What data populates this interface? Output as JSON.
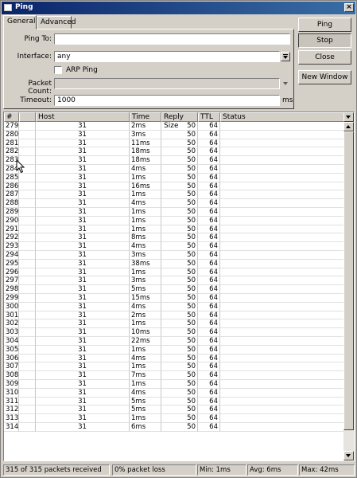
{
  "window": {
    "title": "Ping",
    "close_glyph": "×"
  },
  "tabs": [
    {
      "label": "General"
    },
    {
      "label": "Advanced"
    }
  ],
  "form": {
    "ping_to": {
      "label": "Ping To:",
      "value": ""
    },
    "interface": {
      "label": "Interface:",
      "value": "any"
    },
    "arp_ping": {
      "label": "ARP Ping",
      "checked": false
    },
    "packet_count": {
      "label": "Packet Count:",
      "value": ""
    },
    "timeout": {
      "label": "Timeout:",
      "value": "1000",
      "unit": "ms"
    }
  },
  "buttons": {
    "ping": "Ping",
    "stop": "Stop",
    "close": "Close",
    "new_window": "New Window"
  },
  "table": {
    "columns": [
      "#",
      "Host",
      "Time",
      "Reply Size",
      "TTL",
      "Status"
    ],
    "rows": [
      [
        "279",
        "31",
        "2ms",
        "50",
        "64",
        ""
      ],
      [
        "280",
        "31",
        "3ms",
        "50",
        "64",
        ""
      ],
      [
        "281",
        "31",
        "11ms",
        "50",
        "64",
        ""
      ],
      [
        "282",
        "31",
        "18ms",
        "50",
        "64",
        ""
      ],
      [
        "283",
        "31",
        "18ms",
        "50",
        "64",
        ""
      ],
      [
        "284",
        "31",
        "4ms",
        "50",
        "64",
        ""
      ],
      [
        "285",
        "31",
        "1ms",
        "50",
        "64",
        ""
      ],
      [
        "286",
        "31",
        "16ms",
        "50",
        "64",
        ""
      ],
      [
        "287",
        "31",
        "1ms",
        "50",
        "64",
        ""
      ],
      [
        "288",
        "31",
        "4ms",
        "50",
        "64",
        ""
      ],
      [
        "289",
        "31",
        "1ms",
        "50",
        "64",
        ""
      ],
      [
        "290",
        "31",
        "1ms",
        "50",
        "64",
        ""
      ],
      [
        "291",
        "31",
        "1ms",
        "50",
        "64",
        ""
      ],
      [
        "292",
        "31",
        "8ms",
        "50",
        "64",
        ""
      ],
      [
        "293",
        "31",
        "4ms",
        "50",
        "64",
        ""
      ],
      [
        "294",
        "31",
        "3ms",
        "50",
        "64",
        ""
      ],
      [
        "295",
        "31",
        "38ms",
        "50",
        "64",
        ""
      ],
      [
        "296",
        "31",
        "1ms",
        "50",
        "64",
        ""
      ],
      [
        "297",
        "31",
        "3ms",
        "50",
        "64",
        ""
      ],
      [
        "298",
        "31",
        "5ms",
        "50",
        "64",
        ""
      ],
      [
        "299",
        "31",
        "15ms",
        "50",
        "64",
        ""
      ],
      [
        "300",
        "31",
        "4ms",
        "50",
        "64",
        ""
      ],
      [
        "301",
        "31",
        "2ms",
        "50",
        "64",
        ""
      ],
      [
        "302",
        "31",
        "1ms",
        "50",
        "64",
        ""
      ],
      [
        "303",
        "31",
        "10ms",
        "50",
        "64",
        ""
      ],
      [
        "304",
        "31",
        "22ms",
        "50",
        "64",
        ""
      ],
      [
        "305",
        "31",
        "1ms",
        "50",
        "64",
        ""
      ],
      [
        "306",
        "31",
        "4ms",
        "50",
        "64",
        ""
      ],
      [
        "307",
        "31",
        "1ms",
        "50",
        "64",
        ""
      ],
      [
        "308",
        "31",
        "7ms",
        "50",
        "64",
        ""
      ],
      [
        "309",
        "31",
        "1ms",
        "50",
        "64",
        ""
      ],
      [
        "310",
        "31",
        "4ms",
        "50",
        "64",
        ""
      ],
      [
        "311",
        "31",
        "5ms",
        "50",
        "64",
        ""
      ],
      [
        "312",
        "31",
        "5ms",
        "50",
        "64",
        ""
      ],
      [
        "313",
        "31",
        "1ms",
        "50",
        "64",
        ""
      ],
      [
        "314",
        "31",
        "6ms",
        "50",
        "64",
        ""
      ]
    ]
  },
  "status": {
    "received": "315 of 315 packets received",
    "loss": "0% packet loss",
    "min": "Min: 1ms",
    "avg": "Avg: 6ms",
    "max": "Max: 42ms"
  }
}
